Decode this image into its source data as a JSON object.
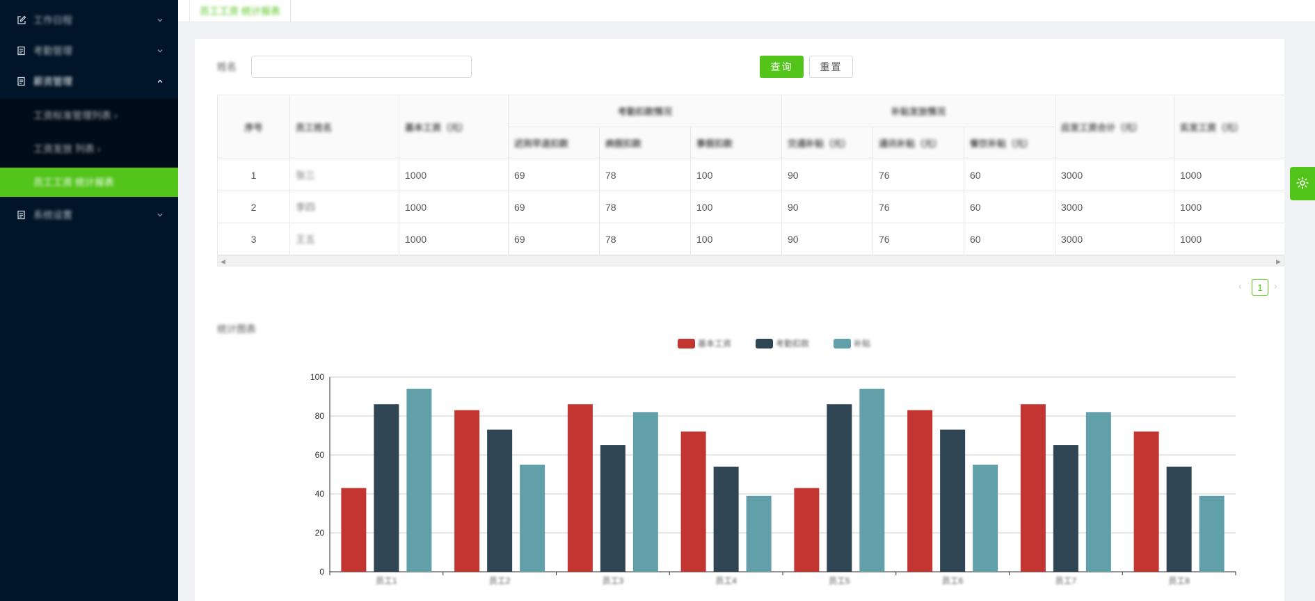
{
  "sidebar": {
    "items": [
      {
        "label": "工作日程",
        "icon": "edit-icon",
        "expanded": false
      },
      {
        "label": "考勤管理",
        "icon": "form-icon",
        "expanded": false
      },
      {
        "label": "薪资管理",
        "icon": "form-icon",
        "expanded": true
      },
      {
        "label": "系统设置",
        "icon": "form-icon",
        "expanded": false
      }
    ],
    "subitems": [
      {
        "label": "工资标准管理列表 ›",
        "active": false
      },
      {
        "label": "工资发放 列表 ›",
        "active": false
      },
      {
        "label": "员工工资 统计报表",
        "active": true
      }
    ]
  },
  "tabs": [
    {
      "label": "员工工资 统计报表"
    }
  ],
  "search": {
    "label": "姓名",
    "value": "",
    "placeholder": ""
  },
  "buttons": {
    "query": "查询",
    "reset": "重置"
  },
  "table": {
    "headers": {
      "index": "序号",
      "name": "员工姓名",
      "base": "基本工资（元）",
      "group1": "考勤扣款情况",
      "group1_cols": [
        "迟到早退扣款",
        "病假扣款",
        "事假扣款"
      ],
      "group2": "补贴发放情况",
      "group2_cols": [
        "交通补贴（元）",
        "通讯补贴（元）",
        "餐饮补贴（元）"
      ],
      "total": "应发工资合计（元）",
      "actual": "实发工资（元）"
    },
    "rows": [
      {
        "index": "1",
        "name": "张三",
        "base": "1000",
        "g1a": "69",
        "g1b": "78",
        "g1c": "100",
        "g2a": "90",
        "g2b": "76",
        "g2c": "60",
        "total": "3000",
        "actual": "1000"
      },
      {
        "index": "2",
        "name": "李四",
        "base": "1000",
        "g1a": "69",
        "g1b": "78",
        "g1c": "100",
        "g2a": "90",
        "g2b": "76",
        "g2c": "60",
        "total": "3000",
        "actual": "1000"
      },
      {
        "index": "3",
        "name": "王五",
        "base": "1000",
        "g1a": "69",
        "g1b": "78",
        "g1c": "100",
        "g2a": "90",
        "g2b": "76",
        "g2c": "60",
        "total": "3000",
        "actual": "1000"
      }
    ]
  },
  "pagination": {
    "current": "1",
    "prev": "‹",
    "next": "›"
  },
  "chart_section_title": "统计图表",
  "colors": {
    "accent": "#52c41a",
    "sidebar_bg": "#001529",
    "series1": "#c23531",
    "series2": "#2f4554",
    "series3": "#61a0a8"
  },
  "chart_data": {
    "type": "bar",
    "categories": [
      "员工1",
      "员工2",
      "员工3",
      "员工4",
      "员工5",
      "员工6",
      "员工7",
      "员工8"
    ],
    "series": [
      {
        "name": "基本工资",
        "values": [
          43,
          83,
          86,
          72,
          43,
          83,
          86,
          72
        ]
      },
      {
        "name": "考勤扣款",
        "values": [
          86,
          73,
          65,
          54,
          86,
          73,
          65,
          54
        ]
      },
      {
        "name": "补贴",
        "values": [
          94,
          55,
          82,
          39,
          94,
          55,
          82,
          39
        ]
      }
    ],
    "yticks": [
      "0",
      "20",
      "40",
      "60",
      "80",
      "100"
    ],
    "ylim": [
      0,
      100
    ],
    "grid": true,
    "legend_position": "top-center"
  }
}
